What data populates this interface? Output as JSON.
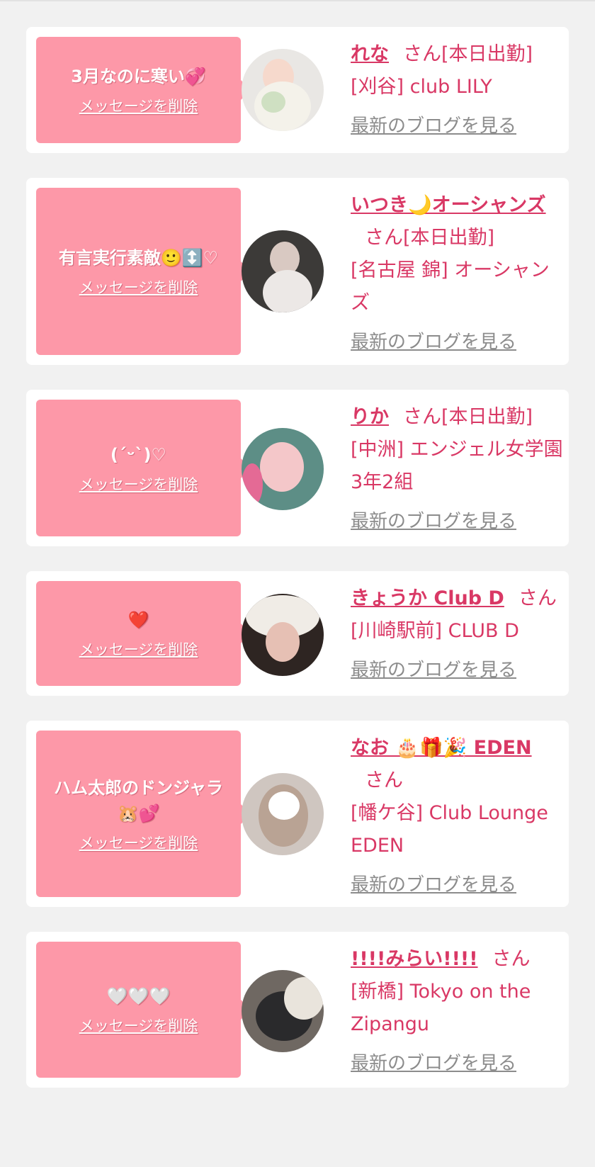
{
  "delete_label": "メッセージを削除",
  "blog_label": "最新のブログを見る",
  "items": [
    {
      "message": "3月なのに寒い💞",
      "girl_name": "れな",
      "suffix": "さん[本日出勤]",
      "shop": "[刈谷] club LILY"
    },
    {
      "message": "有言実行素敵🙂↕️♡",
      "girl_name": "いつき🌙オーシャンズ",
      "suffix": "さん[本日出勤]",
      "shop": "[名古屋 錦] オーシャンズ"
    },
    {
      "message": "(ˊᵕˋ)♡",
      "girl_name": "りか",
      "suffix": "さん[本日出勤]",
      "shop": "[中洲] エンジェル女学園 3年2組"
    },
    {
      "message": "❤️",
      "girl_name": "きょうか Club D",
      "suffix": "さん",
      "shop": "[川崎駅前] CLUB D"
    },
    {
      "message": "ハム太郎のドンジャラ🐹💕",
      "girl_name": "なお 🎂🎁🎉 EDEN",
      "suffix": "さん",
      "shop": "[幡ケ谷] Club Lounge EDEN"
    },
    {
      "message": "🤍🤍🤍",
      "girl_name": "!!!!みらい!!!!",
      "suffix": "さん",
      "shop": "[新橋] Tokyo on the Zipangu"
    }
  ]
}
